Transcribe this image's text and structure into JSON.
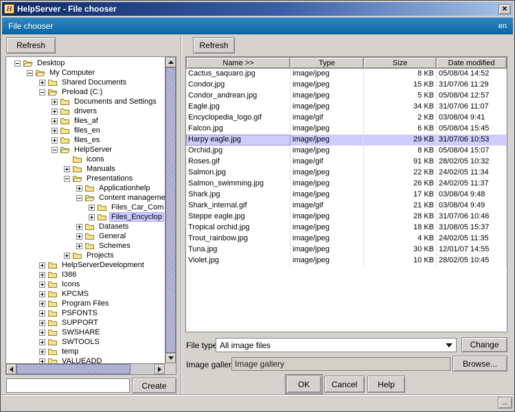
{
  "window": {
    "title": "HelpServer - File chooser",
    "icon_letter": "H",
    "close_label": "✕"
  },
  "banner": {
    "title": "File chooser",
    "lang": "en"
  },
  "accent_colors": {
    "titlebar_gradient_start": "#0c2a66",
    "titlebar_gradient_end": "#a8c4e8",
    "banner_blue": "#0d67a6",
    "selection_highlight": "#ccccff",
    "scrollbar_thumb": "#a3a3c9",
    "folder_yellow": "#f6e28d"
  },
  "left": {
    "refresh_label": "Refresh",
    "create_label": "Create",
    "create_value": "",
    "tree": [
      {
        "label": "Desktop",
        "level": 0,
        "expander": "minus",
        "open": true,
        "selected": false
      },
      {
        "label": "My Computer",
        "level": 1,
        "expander": "minus",
        "open": true,
        "selected": false
      },
      {
        "label": "Shared Documents",
        "level": 2,
        "expander": "plus",
        "open": false,
        "selected": false
      },
      {
        "label": "Preload (C:)",
        "level": 2,
        "expander": "minus",
        "open": true,
        "selected": false
      },
      {
        "label": "Documents and Settings",
        "level": 3,
        "expander": "plus",
        "open": false,
        "selected": false
      },
      {
        "label": "drivers",
        "level": 3,
        "expander": "plus",
        "open": false,
        "selected": false
      },
      {
        "label": "files_af",
        "level": 3,
        "expander": "plus",
        "open": false,
        "selected": false
      },
      {
        "label": "files_en",
        "level": 3,
        "expander": "plus",
        "open": false,
        "selected": false
      },
      {
        "label": "files_es",
        "level": 3,
        "expander": "plus",
        "open": false,
        "selected": false
      },
      {
        "label": "HelpServer",
        "level": 3,
        "expander": "minus",
        "open": true,
        "selected": false
      },
      {
        "label": "icons",
        "level": 4,
        "expander": "none",
        "open": false,
        "selected": false
      },
      {
        "label": "Manuals",
        "level": 4,
        "expander": "plus",
        "open": false,
        "selected": false
      },
      {
        "label": "Presentations",
        "level": 4,
        "expander": "minus",
        "open": true,
        "selected": false
      },
      {
        "label": "Applicationhelp",
        "level": 5,
        "expander": "plus",
        "open": false,
        "selected": false
      },
      {
        "label": "Content manageme",
        "level": 5,
        "expander": "minus",
        "open": true,
        "selected": false
      },
      {
        "label": "Files_Car_Com",
        "level": 6,
        "expander": "plus",
        "open": false,
        "selected": false
      },
      {
        "label": "Files_Encyclop",
        "level": 6,
        "expander": "plus",
        "open": false,
        "selected": true
      },
      {
        "label": "Datasets",
        "level": 5,
        "expander": "plus",
        "open": false,
        "selected": false
      },
      {
        "label": "General",
        "level": 5,
        "expander": "plus",
        "open": false,
        "selected": false
      },
      {
        "label": "Schemes",
        "level": 5,
        "expander": "plus",
        "open": false,
        "selected": false
      },
      {
        "label": "Projects",
        "level": 4,
        "expander": "plus",
        "open": false,
        "selected": false
      },
      {
        "label": "HelpServerDevelopment",
        "level": 2,
        "expander": "plus",
        "open": false,
        "selected": false
      },
      {
        "label": "I386",
        "level": 2,
        "expander": "plus",
        "open": false,
        "selected": false
      },
      {
        "label": "Icons",
        "level": 2,
        "expander": "plus",
        "open": false,
        "selected": false
      },
      {
        "label": "KPCMS",
        "level": 2,
        "expander": "plus",
        "open": false,
        "selected": false
      },
      {
        "label": "Program Files",
        "level": 2,
        "expander": "plus",
        "open": false,
        "selected": false
      },
      {
        "label": "PSFONTS",
        "level": 2,
        "expander": "plus",
        "open": false,
        "selected": false
      },
      {
        "label": "SUPPORT",
        "level": 2,
        "expander": "plus",
        "open": false,
        "selected": false
      },
      {
        "label": "SWSHARE",
        "level": 2,
        "expander": "plus",
        "open": false,
        "selected": false
      },
      {
        "label": "SWTOOLS",
        "level": 2,
        "expander": "plus",
        "open": false,
        "selected": false
      },
      {
        "label": "temp",
        "level": 2,
        "expander": "plus",
        "open": false,
        "selected": false
      },
      {
        "label": "VALUEADD",
        "level": 2,
        "expander": "plus",
        "open": false,
        "selected": false
      }
    ]
  },
  "right": {
    "refresh_label": "Refresh",
    "table": {
      "columns": [
        "Name >>",
        "Type",
        "Size",
        "Date modified"
      ],
      "selected_row": 6,
      "rows": [
        [
          "Cactus_saquaro.jpg",
          "image/jpeg",
          "8 KB",
          "05/08/04 14:52"
        ],
        [
          "Condor.jpg",
          "image/jpeg",
          "15 KB",
          "31/07/06 11:29"
        ],
        [
          "Condor_andrean.jpg",
          "image/jpeg",
          "5 KB",
          "05/08/04 12:57"
        ],
        [
          "Eagle.jpg",
          "image/jpeg",
          "34 KB",
          "31/07/06 11:07"
        ],
        [
          "Encyclopedia_logo.gif",
          "image/gif",
          "2 KB",
          "03/08/04 9:41"
        ],
        [
          "Falcon.jpg",
          "image/jpeg",
          "6 KB",
          "05/08/04 15:45"
        ],
        [
          "Harpy eagle.jpg",
          "image/jpeg",
          "29 KB",
          "31/07/06 10:53"
        ],
        [
          "Orchid.jpg",
          "image/jpeg",
          "8 KB",
          "05/08/04 15:07"
        ],
        [
          "Roses.gif",
          "image/gif",
          "91 KB",
          "28/02/05 10:32"
        ],
        [
          "Salmon.jpg",
          "image/jpeg",
          "22 KB",
          "24/02/05 11:34"
        ],
        [
          "Salmon_swimming.jpg",
          "image/jpeg",
          "26 KB",
          "24/02/05 11:37"
        ],
        [
          "Shark.jpg",
          "image/jpeg",
          "17 KB",
          "03/08/04 9:48"
        ],
        [
          "Shark_internal.gif",
          "image/gif",
          "21 KB",
          "03/08/04 9:49"
        ],
        [
          "Steppe eagle.jpg",
          "image/jpeg",
          "28 KB",
          "31/07/06 10:46"
        ],
        [
          "Tropical orchid.jpg",
          "image/jpeg",
          "18 KB",
          "31/08/05 15:37"
        ],
        [
          "Trout_rainbow.jpg",
          "image/jpeg",
          "4 KB",
          "24/02/05 11:35"
        ],
        [
          "Tuna.jpg",
          "image/jpeg",
          "30 KB",
          "12/01/07 14:55"
        ],
        [
          "Violet.jpg",
          "image/jpeg",
          "10 KB",
          "28/02/05 10:45"
        ]
      ]
    },
    "filetype": {
      "label": "File type",
      "value": "All image files"
    },
    "change_label": "Change",
    "gallery": {
      "label": "Image gallery",
      "value": "Image gallery"
    },
    "browse_label": "Browse...",
    "ok_label": "OK",
    "cancel_label": "Cancel",
    "help_label": "Help"
  },
  "statusbar": {
    "more_label": "..."
  }
}
